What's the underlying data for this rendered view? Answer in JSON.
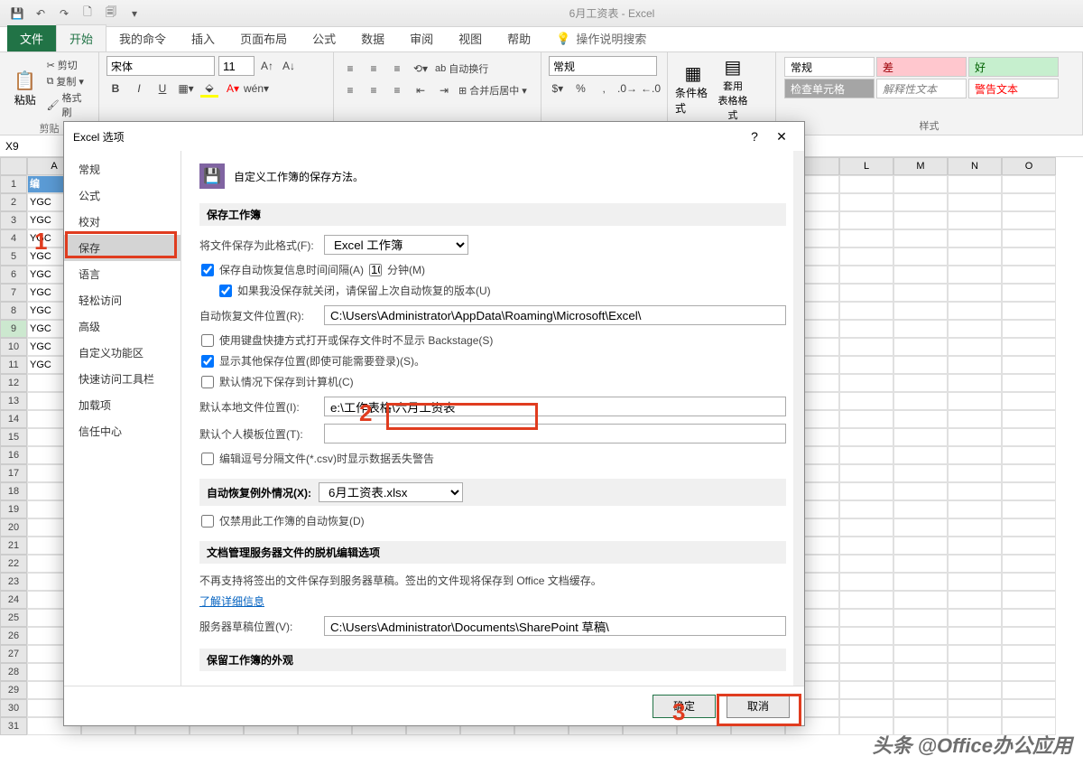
{
  "app": {
    "title": "6月工资表 - Excel"
  },
  "qat": {
    "save": "💾",
    "undo": "↶",
    "redo": "↷",
    "new": "🗋",
    "quickprint": "🗐"
  },
  "tabs": {
    "file": "文件",
    "home": "开始",
    "myCmd": "我的命令",
    "insert": "插入",
    "layout": "页面布局",
    "formula": "公式",
    "data": "数据",
    "review": "审阅",
    "view": "视图",
    "help": "帮助",
    "tellme": "操作说明搜索"
  },
  "ribbon": {
    "clipboard": {
      "label": "剪贴",
      "paste": "粘贴",
      "cut": "剪切",
      "copy": "复制",
      "painter": "格式刷"
    },
    "font": {
      "name": "宋体",
      "size": "11",
      "bold": "B",
      "italic": "I",
      "underline": "U"
    },
    "align": {
      "wrap": "自动换行",
      "merge": "合并后居中"
    },
    "number": {
      "general": "常规"
    },
    "styles": {
      "label": "样式",
      "cond": "条件格式",
      "table": "套用\n表格格式",
      "normal": "常规",
      "bad": "差",
      "good": "好",
      "check": "检查单元格",
      "explain": "解释性文本",
      "warn": "警告文本"
    }
  },
  "namebox": "X9",
  "gridCols": [
    "A",
    "L",
    "M",
    "N",
    "O"
  ],
  "gridRows": {
    "r1": "编",
    "r2_31": "YGC"
  },
  "dialog": {
    "title": "Excel 选项",
    "nav": [
      "常规",
      "公式",
      "校对",
      "保存",
      "语言",
      "轻松访问",
      "高级",
      "自定义功能区",
      "快速访问工具栏",
      "加载项",
      "信任中心"
    ],
    "navSelected": "保存",
    "heading": "自定义工作簿的保存方法。",
    "sec_save": "保存工作簿",
    "fmt_label": "将文件保存为此格式(F):",
    "fmt_value": "Excel 工作簿",
    "autosave_check": "保存自动恢复信息时间间隔(A)",
    "autosave_minutes": "10",
    "minutes_lbl": "分钟(M)",
    "keep_last": "如果我没保存就关闭，请保留上次自动恢复的版本(U)",
    "autorecover_loc_label": "自动恢复文件位置(R):",
    "autorecover_loc": "C:\\Users\\Administrator\\AppData\\Roaming\\Microsoft\\Excel\\",
    "backstage": "使用键盘快捷方式打开或保存文件时不显示 Backstage(S)",
    "show_addl": "显示其他保存位置(即使可能需要登录)(S)。",
    "default_computer": "默认情况下保存到计算机(C)",
    "default_loc_label": "默认本地文件位置(I):",
    "default_loc": "e:\\工作表格\\六月工资表",
    "tmpl_loc_label": "默认个人模板位置(T):",
    "tmpl_loc": "",
    "csv_warn": "编辑逗号分隔文件(*.csv)时显示数据丢失警告",
    "sec_except": "自动恢复例外情况(X):",
    "except_file": "6月工资表.xlsx",
    "disable_autorecover": "仅禁用此工作簿的自动恢复(D)",
    "sec_offline": "文档管理服务器文件的脱机编辑选项",
    "offline_note": "不再支持将签出的文件保存到服务器草稿。签出的文件现将保存到 Office 文档缓存。",
    "learn_more": "了解详细信息",
    "draft_loc_label": "服务器草稿位置(V):",
    "draft_loc": "C:\\Users\\Administrator\\Documents\\SharePoint 草稿\\",
    "sec_appearance": "保留工作簿的外观",
    "ok": "确定",
    "cancel": "取消"
  },
  "annotations": {
    "n1": "1",
    "n2": "2",
    "n3": "3"
  },
  "watermark": "头条 @Office办公应用"
}
